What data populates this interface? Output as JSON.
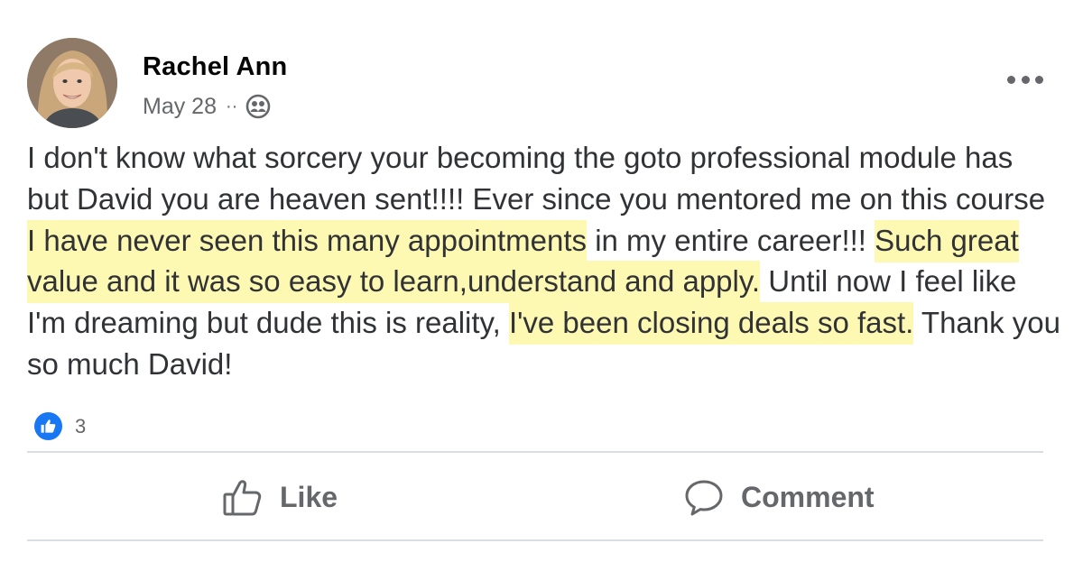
{
  "post": {
    "author": "Rachel Ann",
    "date": "May 28",
    "separator": "··",
    "audience_icon": "friends-icon",
    "more_icon": "more-options-icon",
    "body": [
      {
        "text": "I don't know what sorcery your becoming the goto professional module has but David you are heaven sent!!!! Ever since you mentored me on this course ",
        "highlight": false
      },
      {
        "text": "I have never seen this many appointments",
        "highlight": true
      },
      {
        "text": " in my entire career!!! ",
        "highlight": false
      },
      {
        "text": "Such great value and it was so easy to learn,understand and apply.",
        "highlight": true
      },
      {
        "text": " Until now I feel like I'm dreaming but dude this is reality, ",
        "highlight": false
      },
      {
        "text": "I've been closing deals so fast.",
        "highlight": true
      },
      {
        "text": " Thank you so much David!",
        "highlight": false
      }
    ],
    "reaction_count": "3",
    "reaction_icon": "like-reaction-icon"
  },
  "actions": {
    "like_label": "Like",
    "comment_label": "Comment"
  },
  "colors": {
    "highlight": "#fdf8b2",
    "brand_blue": "#1877f2",
    "secondary_text": "#65676b"
  }
}
